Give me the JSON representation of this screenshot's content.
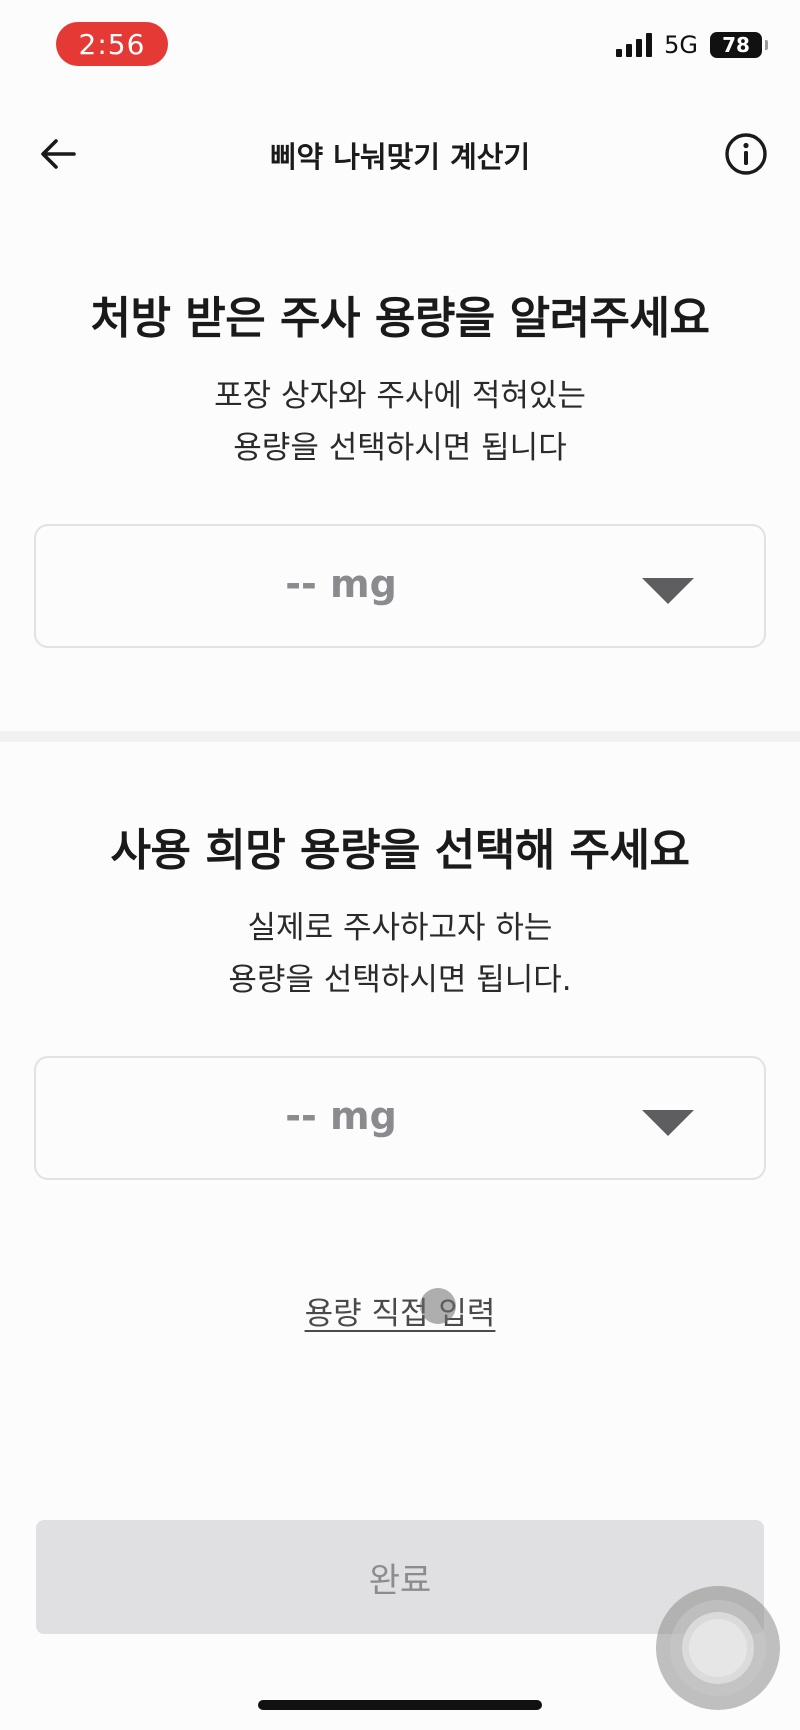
{
  "status_bar": {
    "time": "2:56",
    "network": "5G",
    "battery": "78",
    "colors": {
      "time_pill": "#e53935"
    }
  },
  "nav": {
    "title": "삐약 나눠맞기 계산기",
    "back_icon": "arrow-left-icon",
    "info_icon": "info-circle-icon"
  },
  "prescribed": {
    "heading": "처방 받은 주사 용량을 알려주세요",
    "desc_line1": "포장 상자와 주사에 적혀있는",
    "desc_line2": "용량을 선택하시면 됩니다",
    "selected_value": "-- mg",
    "caret_icon": "caret-down-icon"
  },
  "desired": {
    "heading": "사용 희망 용량을 선택해 주세요",
    "desc_line1": "실제로 주사하고자 하는",
    "desc_line2": "용량을 선택하시면 됩니다.",
    "selected_value": "-- mg",
    "caret_icon": "caret-down-icon"
  },
  "manual_entry": {
    "label": "용량 직접 입력"
  },
  "done_button": {
    "label": "완료",
    "enabled": false
  }
}
